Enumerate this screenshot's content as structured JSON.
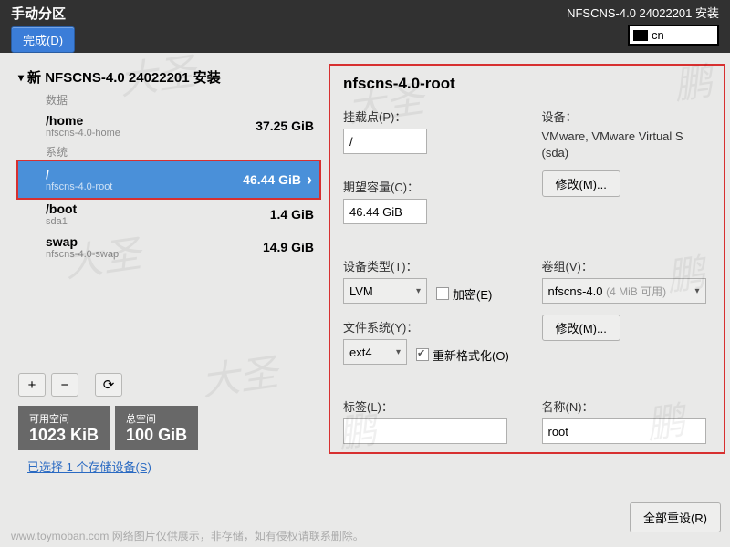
{
  "topbar": {
    "title_left": "手动分区",
    "done_label": "完成(D)",
    "title_right": "NFSCNS-4.0 24022201 安装",
    "keyboard": "cn"
  },
  "tree": {
    "header": "新 NFSCNS-4.0 24022201 安装",
    "sections": {
      "data_label": "数据",
      "system_label": "系统"
    },
    "partitions": [
      {
        "mount": "/home",
        "dev": "nfscns-4.0-home",
        "size": "37.25 GiB",
        "selected": false
      },
      {
        "mount": "/",
        "dev": "nfscns-4.0-root",
        "size": "46.44 GiB",
        "selected": true
      },
      {
        "mount": "/boot",
        "dev": "sda1",
        "size": "1.4 GiB",
        "selected": false
      },
      {
        "mount": "swap",
        "dev": "nfscns-4.0-swap",
        "size": "14.9 GiB",
        "selected": false
      }
    ]
  },
  "toolbar": {
    "add": "+",
    "remove": "−",
    "reload": "⟳"
  },
  "space": {
    "avail_label": "可用空间",
    "avail_value": "1023 KiB",
    "total_label": "总空间",
    "total_value": "100 GiB"
  },
  "storage_link": "已选择 1 个存储设备(S)",
  "detail": {
    "title": "nfscns-4.0-root",
    "mount_label": "挂载点(P)：",
    "mount_value": "/",
    "capacity_label": "期望容量(C)：",
    "capacity_value": "46.44 GiB",
    "device_label": "设备：",
    "device_value": "VMware, VMware Virtual S (sda)",
    "modify_label": "修改(M)...",
    "devtype_label": "设备类型(T)：",
    "devtype_value": "LVM",
    "encrypt_label": "加密(E)",
    "vg_label": "卷组(V)：",
    "vg_value": "nfscns-4.0",
    "vg_extra": "(4 MiB 可用)",
    "fs_label": "文件系统(Y)：",
    "fs_value": "ext4",
    "reformat_label": "重新格式化(O)",
    "tag_label": "标签(L)：",
    "tag_value": "",
    "name_label": "名称(N)：",
    "name_value": "root"
  },
  "reset_label": "全部重设(R)",
  "footer_note": "www.toymoban.com  网络图片仅供展示，非存储，如有侵权请联系删除。",
  "watermarks": {
    "cn": "大圣",
    "en": "鹏"
  }
}
